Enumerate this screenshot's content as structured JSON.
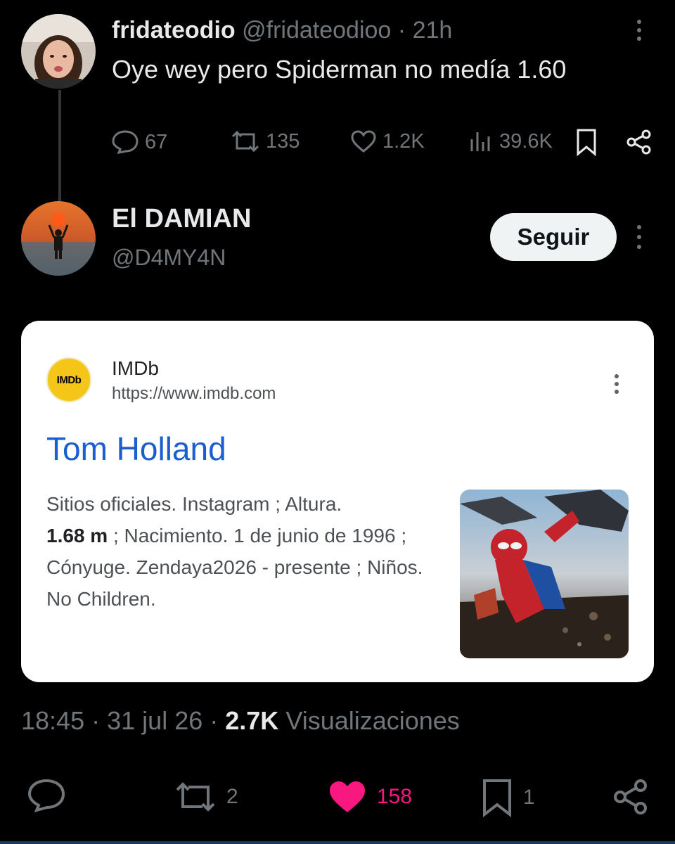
{
  "parent_tweet": {
    "display_name": "fridateodio",
    "handle": "@fridateodioo",
    "separator": "·",
    "time_ago": "21h",
    "text": "Oye wey pero Spiderman no medía 1.60",
    "replies": "67",
    "retweets": "135",
    "likes": "1.2K",
    "views": "39.6K"
  },
  "reply_tweet": {
    "display_name": "El DAMIAN",
    "handle": "@D4MY4N",
    "follow_label": "Seguir"
  },
  "embedded_result": {
    "logo_text": "IMDb",
    "site_name": "IMDb",
    "url": "https://www.imdb.com",
    "title": "Tom Holland",
    "snippet_part1": "Sitios oficiales. Instagram ; Altura.",
    "snippet_bold": "1.68 m",
    "snippet_part2": " ; Nacimiento. 1 de junio de 1996 ; Cónyuge. Zendaya2026 - presente ; Niños. No Children."
  },
  "meta": {
    "time": "18:45",
    "dot1": "·",
    "date": "31 jul 26",
    "dot2": "·",
    "views_count": "2.7K",
    "views_label": "Visualizaciones"
  },
  "reply_actions": {
    "retweets": "2",
    "likes": "158",
    "bookmarks": "1"
  },
  "colors": {
    "background": "#000000",
    "secondary_text": "#71767b",
    "like_pink": "#f91880",
    "link_blue": "#1a5ecf",
    "imdb_yellow": "#f5c518"
  }
}
